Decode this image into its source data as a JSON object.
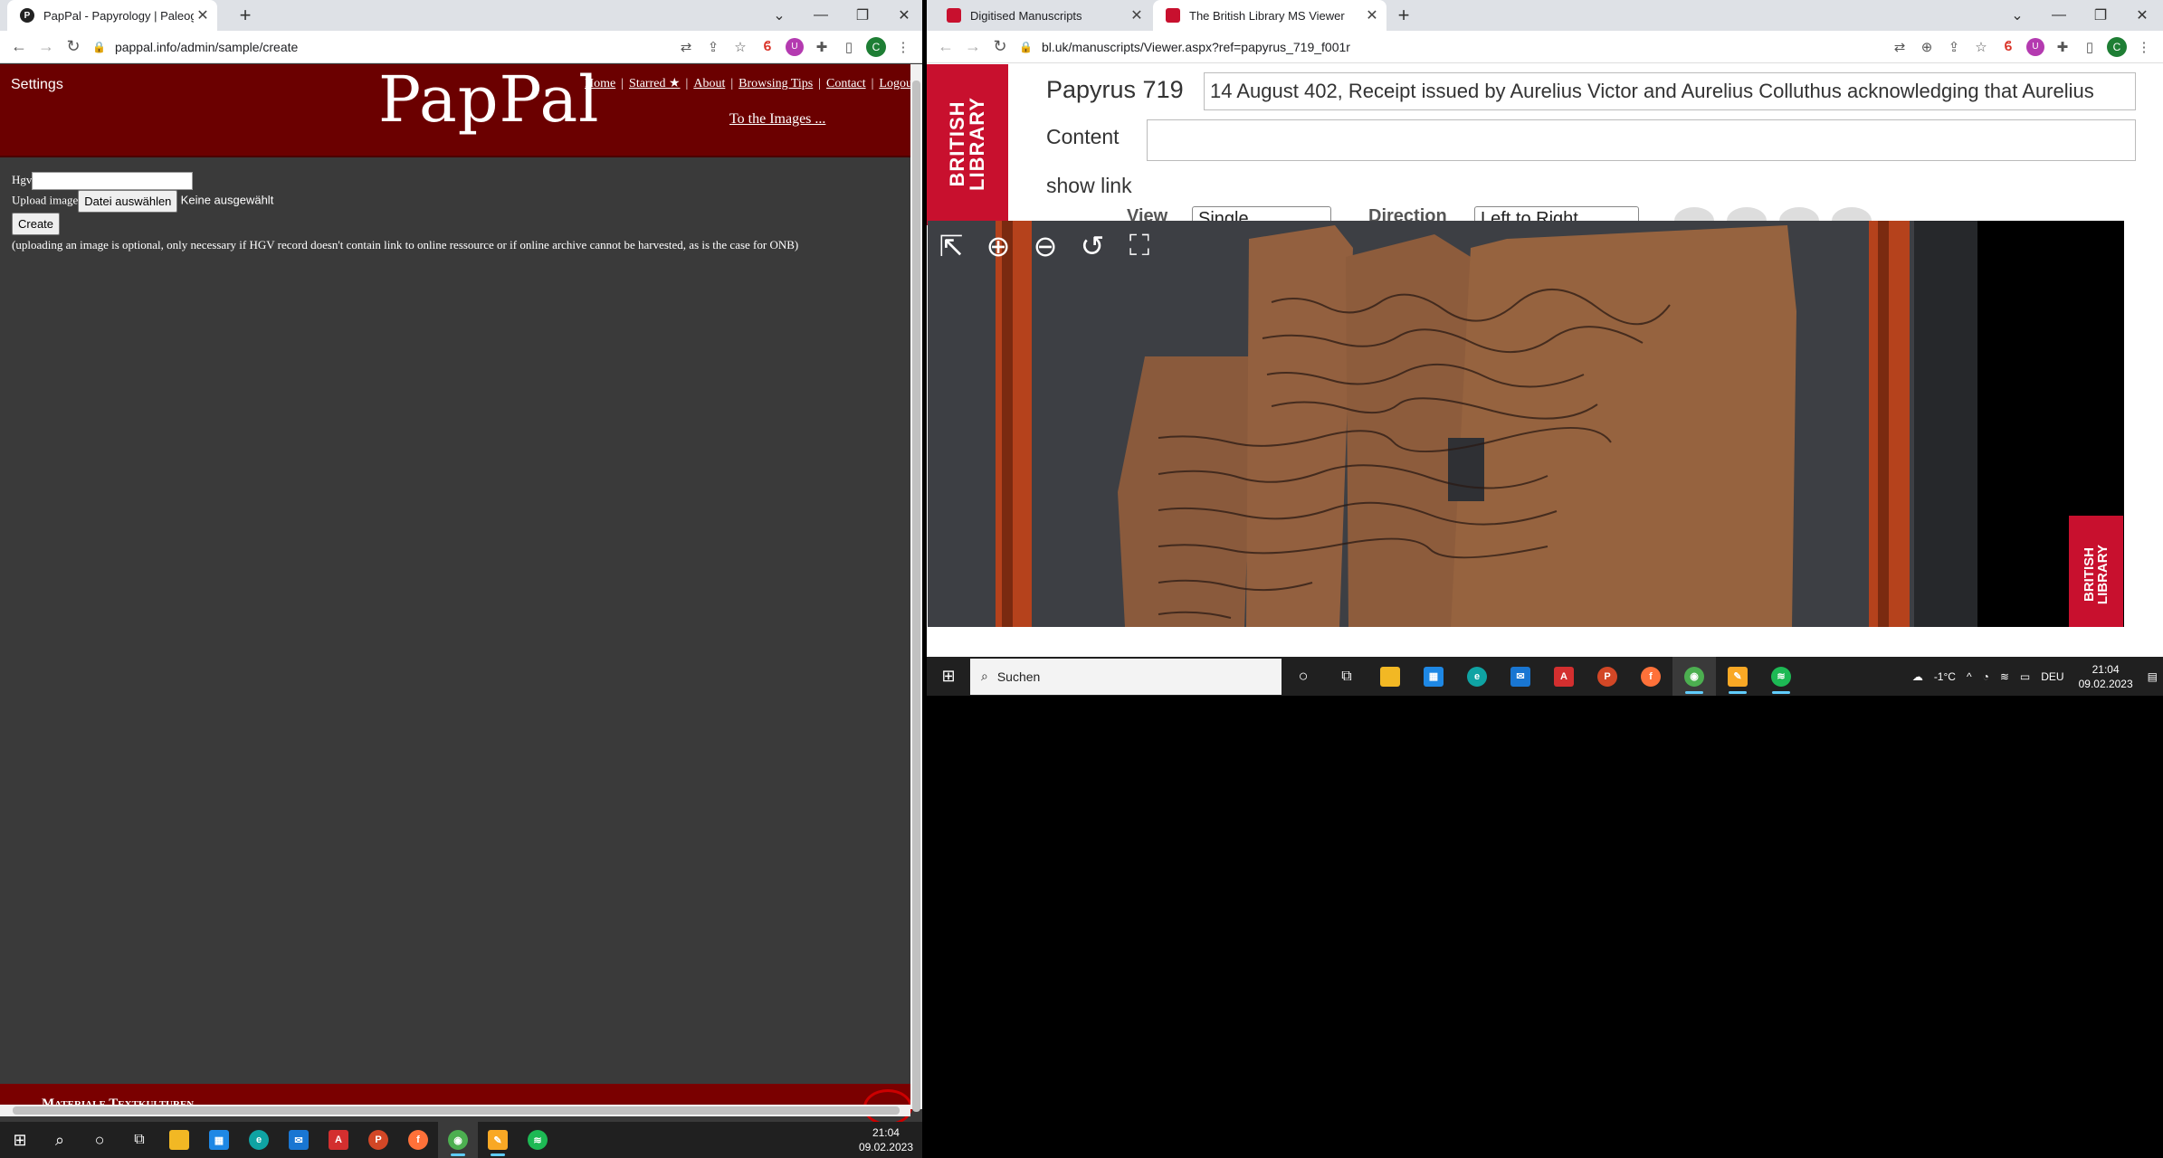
{
  "left_window": {
    "tab": {
      "title": "PapPal - Papyrology | Paleograph",
      "close": "✕"
    },
    "new_tab": "+",
    "url": "pappal.info/admin/sample/create",
    "page": {
      "settings": "Settings",
      "logo": "PapPal",
      "nav": [
        "Home",
        "Starred ★",
        "About",
        "Browsing Tips",
        "Contact",
        "Logout"
      ],
      "to_images": "To the Images ...",
      "hgv_label": "Hgv",
      "hgv_value": "",
      "upload_label": "Upload image",
      "choose_file": "Datei auswählen",
      "no_file": "Keine ausgewählt",
      "create": "Create",
      "note": "(uploading an image is optional, only necessary if HGV record doesn't contain link to online ressource or if online archive cannot be harvested, as is the case for ONB)",
      "footer": "Materiale Textkulturen"
    },
    "taskbar": {
      "time": "21:04",
      "date": "09.02.2023"
    }
  },
  "right_window": {
    "tabs": [
      {
        "title": "Digitised Manuscripts"
      },
      {
        "title": "The British Library MS Viewer"
      }
    ],
    "new_tab": "+",
    "url": "bl.uk/manuscripts/Viewer.aspx?ref=papyrus_719_f001r",
    "page": {
      "logo_line1": "BRITISH",
      "logo_line2": "LIBRARY",
      "title": "Papyrus 719",
      "description": "14 August 402, Receipt issued by Aurelius Victor and Aurelius Colluthus acknowledging that Aurelius",
      "content_label": "Content",
      "show_link": "show link",
      "view_label": "View",
      "view_value": "Single",
      "direction_label": "Direction",
      "direction_value": "Left to Right"
    },
    "taskbar": {
      "search": "Suchen",
      "weather": "-1°C",
      "lang": "DEU",
      "time": "21:04",
      "date": "09.02.2023"
    }
  },
  "colors": {
    "pappal_red": "#6b0000",
    "bl_red": "#c8102e",
    "taskbar": "#202020"
  }
}
